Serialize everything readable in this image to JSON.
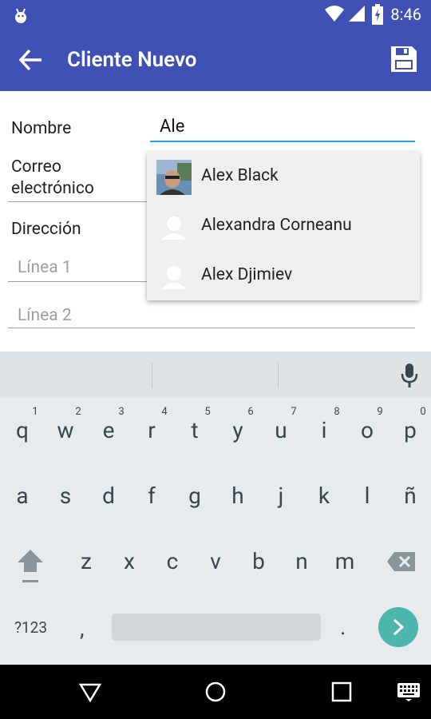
{
  "status_bar": {
    "time": "8:46",
    "left_icon": "android-debug-icon",
    "icons": [
      "wifi-icon",
      "signal-icon",
      "battery-charging-icon"
    ]
  },
  "app_bar": {
    "title": "Cliente Nuevo",
    "back_icon": "arrow-back-icon",
    "save_icon": "floppy-disk-icon"
  },
  "form": {
    "name_label": "Nombre",
    "name_value": "Ale",
    "email_label_line1": "Correo",
    "email_label_line2": "electrónico",
    "address_label": "Dirección",
    "address_line1_placeholder": "Línea 1",
    "address_line2_placeholder": "Línea 2"
  },
  "autocomplete": {
    "items": [
      {
        "name": "Alex Black",
        "avatar": "photo-avatar"
      },
      {
        "name": "Alexandra Corneanu",
        "avatar": "default-person-avatar"
      },
      {
        "name": "Alex Djimiev",
        "avatar": "default-person-avatar"
      }
    ]
  },
  "keyboard": {
    "row1": [
      "q",
      "w",
      "e",
      "r",
      "t",
      "y",
      "u",
      "i",
      "o",
      "p"
    ],
    "row1_hints": [
      "1",
      "2",
      "3",
      "4",
      "5",
      "6",
      "7",
      "8",
      "9",
      "0"
    ],
    "row2": [
      "a",
      "s",
      "d",
      "f",
      "g",
      "h",
      "j",
      "k",
      "l",
      "ñ"
    ],
    "row3": [
      "z",
      "x",
      "c",
      "v",
      "b",
      "n",
      "m"
    ],
    "symbols_key": "?123",
    "comma_key": ",",
    "period_key": ".",
    "mic_icon": "microphone-icon",
    "shift_icon": "shift-arrow-icon",
    "backspace_icon": "backspace-icon",
    "enter_icon": "chevron-right-icon",
    "accent_color": "#4DB6AC"
  },
  "nav_bar": {
    "icons": [
      "back-triangle-icon",
      "home-circle-icon",
      "recents-square-icon",
      "keyboard-switch-icon"
    ]
  },
  "colors": {
    "primary": "#3F51B5",
    "input_focus": "#29A0E0"
  }
}
